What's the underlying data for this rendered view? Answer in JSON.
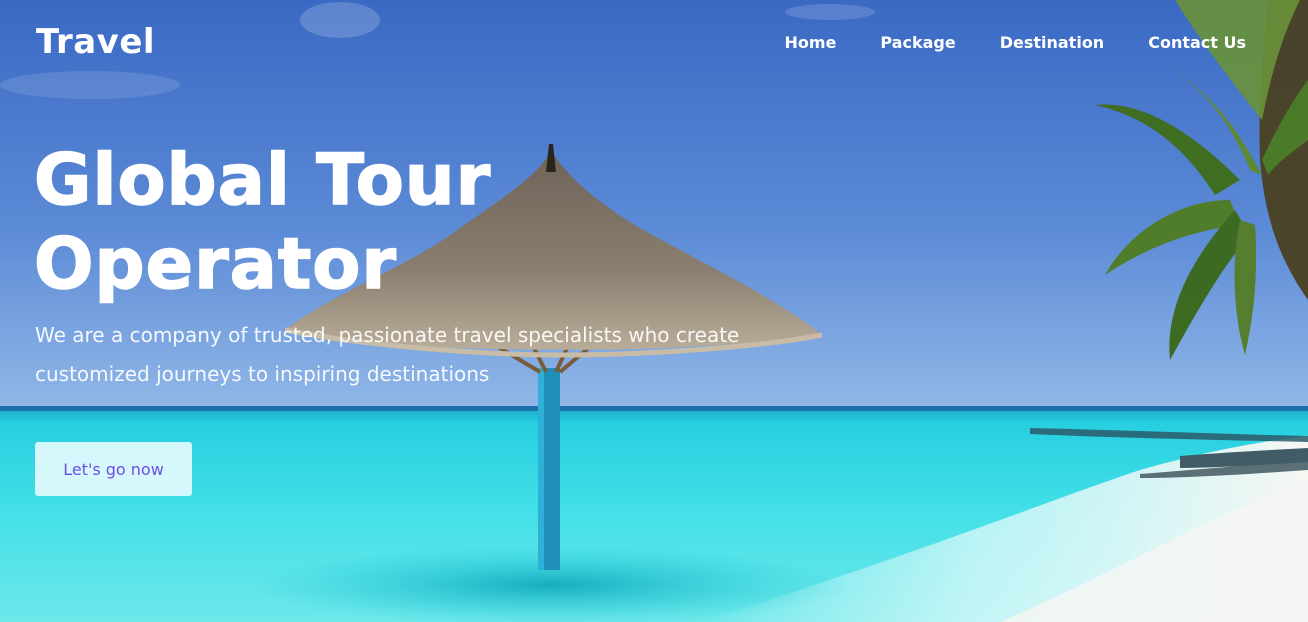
{
  "brand": {
    "logo": "Travel"
  },
  "nav": {
    "items": [
      {
        "label": "Home"
      },
      {
        "label": "Package"
      },
      {
        "label": "Destination"
      },
      {
        "label": "Contact Us"
      }
    ]
  },
  "hero": {
    "title_line1": "Global Tour",
    "title_line2": "Operator",
    "subtitle": "We are a company of trusted, passionate travel specialists who create customized journeys to inspiring destinations",
    "cta_label": "Let's go now"
  },
  "colors": {
    "sky_top": "#3f6fc6",
    "sky_horizon": "#8cb4e8",
    "sea_turquoise": "#22d6e0",
    "sand": "#f3f6f6",
    "cta_text": "#6b4fe0",
    "text": "#ffffff"
  }
}
